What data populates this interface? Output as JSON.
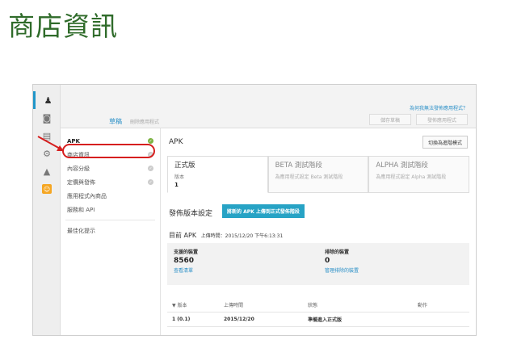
{
  "slide": {
    "title": "商店資訊"
  },
  "rail": {
    "items": [
      {
        "icon": "android-icon",
        "glyph": "♟"
      },
      {
        "icon": "gamepad-icon",
        "glyph": "🎮"
      },
      {
        "icon": "database-icon",
        "glyph": "🛢"
      },
      {
        "icon": "gear-icon",
        "glyph": "⚙"
      },
      {
        "icon": "warning-icon",
        "glyph": "▲"
      },
      {
        "icon": "promo-icon",
        "glyph": "☺"
      }
    ]
  },
  "topbar": {
    "app_name": "草稿",
    "delete_app": "刪除應用程式",
    "help_link": "為何我無法發佈應用程式？",
    "save_draft": "儲存草稿",
    "publish_app": "發佈應用程式"
  },
  "nav": {
    "items": [
      {
        "label": "APK",
        "status": "ok"
      },
      {
        "label": "商店資訊",
        "status": "pending"
      },
      {
        "label": "內容分級",
        "status": "pending"
      },
      {
        "label": "定價與發佈",
        "status": "pending"
      },
      {
        "label": "應用程式內商品",
        "status": "none"
      },
      {
        "label": "服務和 API",
        "status": "none"
      }
    ],
    "optimize": "最佳化提示"
  },
  "main": {
    "heading": "APK",
    "advanced_button": "切換為進階模式",
    "tracks": [
      {
        "name": "正式版",
        "label": "版本",
        "value": "1"
      },
      {
        "name": "BETA 測試階段",
        "label": "為應用程式設定 Beta 測試階段",
        "value": ""
      },
      {
        "name": "ALPHA 測試階段",
        "label": "為應用程式設定 Alpha 測試階段",
        "value": ""
      }
    ],
    "publish_settings": "發佈版本設定",
    "upload_button": "將新的 APK 上傳到正式發佈階段",
    "current_apk": "目前 APK",
    "upload_time": "上傳時間：2015/12/20 下午6:13:31",
    "devices": {
      "supported_label": "支援的裝置",
      "supported_value": "8560",
      "supported_link": "查看清單",
      "excluded_label": "排除的裝置",
      "excluded_value": "0",
      "excluded_link": "管理排除的裝置"
    },
    "table": {
      "headers": [
        "▼ 版本",
        "上傳時間",
        "狀態",
        "動作"
      ],
      "rows": [
        [
          "1 (0.1)",
          "2015/12/20",
          "準備進入正式版",
          ""
        ]
      ]
    }
  },
  "colors": {
    "accent": "#27a3c5",
    "link": "#2a8fc7",
    "highlight": "#d61f1f",
    "ok": "#7cb342",
    "title": "#2f6b2a"
  }
}
